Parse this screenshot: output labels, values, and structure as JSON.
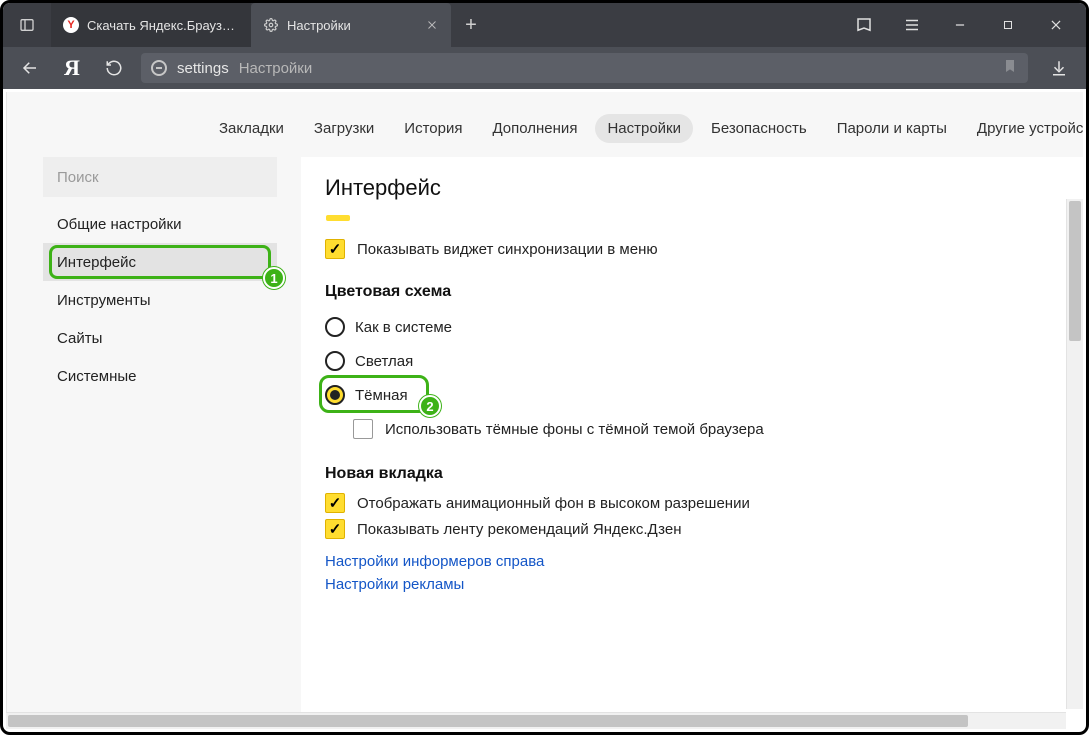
{
  "badges": {
    "one": "1",
    "two": "2"
  },
  "titlebar": {
    "tabs": [
      {
        "title": "Скачать Яндекс.Браузер д",
        "favicon": "Y"
      },
      {
        "title": "Настройки"
      }
    ]
  },
  "addressbar": {
    "path": "settings",
    "page": "Настройки"
  },
  "topnav": {
    "items": [
      "Закладки",
      "Загрузки",
      "История",
      "Дополнения",
      "Настройки",
      "Безопасность",
      "Пароли и карты",
      "Другие устройс"
    ],
    "activeIndex": 4
  },
  "sidebar": {
    "search": "Поиск",
    "items": [
      "Общие настройки",
      "Интерфейс",
      "Инструменты",
      "Сайты",
      "Системные"
    ],
    "selectedIndex": 1
  },
  "main": {
    "title": "Интерфейс",
    "sync_widget": "Показывать виджет синхронизации в меню",
    "color_scheme": {
      "heading": "Цветовая схема",
      "options": [
        "Как в системе",
        "Светлая",
        "Тёмная"
      ],
      "selectedIndex": 2,
      "dark_bg": "Использовать тёмные фоны с тёмной темой браузера"
    },
    "newtab": {
      "heading": "Новая вкладка",
      "hq_anim": "Отображать анимационный фон в высоком разрешении",
      "zen_feed": "Показывать ленту рекомендаций Яндекс.Дзен",
      "link_informers": "Настройки информеров справа",
      "link_ads": "Настройки рекламы"
    }
  }
}
